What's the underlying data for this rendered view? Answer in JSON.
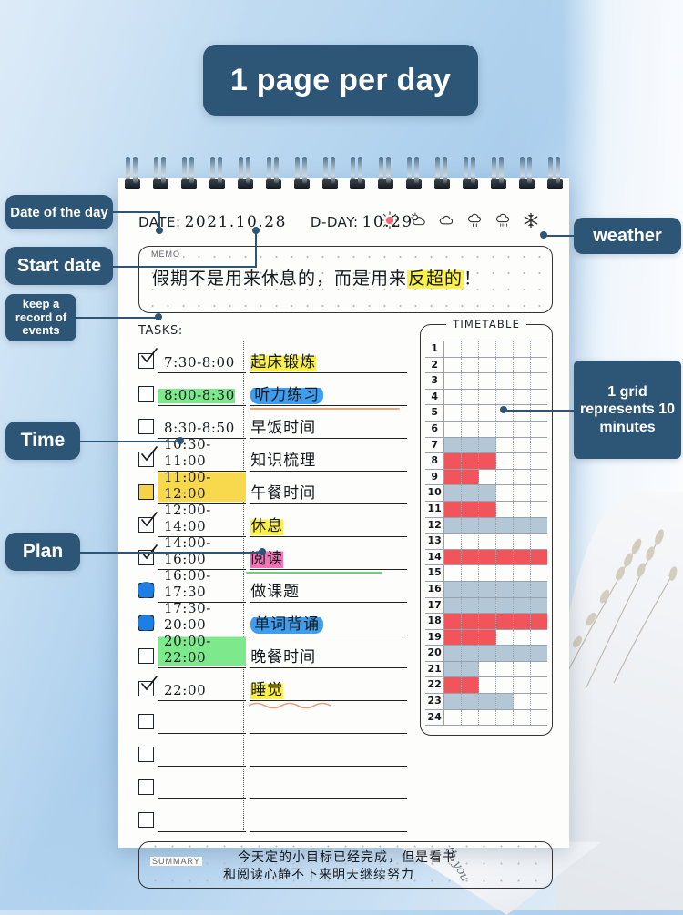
{
  "banner": {
    "title": "1 page per day"
  },
  "callouts": {
    "date_of_day": "Date of the day",
    "start_date": "Start date",
    "keep_record": "keep a record of events",
    "time": "Time",
    "plan": "Plan",
    "weather": "weather",
    "grid_note": "1 grid represents 10 minutes"
  },
  "header": {
    "date_label": "DATE:",
    "date_value": "2021.10.28",
    "dday_label": "D-DAY:",
    "dday_value": "10.29",
    "weather_icons": [
      "sun-icon",
      "sun-cloud-icon",
      "cloud-icon",
      "rain-icon",
      "heavy-rain-icon",
      "snow-icon"
    ]
  },
  "memo": {
    "label": "MEMO",
    "text_plain": "假期不是用来休息的，而是用来",
    "text_highlight": "反超的",
    "text_tail": "！"
  },
  "tasks": {
    "heading": "TASKS:",
    "rows": [
      {
        "check": "checked",
        "time": "7:30-8:00",
        "time_hl": "none",
        "plan": "起床锻炼",
        "plan_hl": "yellow"
      },
      {
        "check": "empty",
        "time": "8:00-8:30",
        "time_hl": "green",
        "plan": "听力练习",
        "plan_hl": "blue"
      },
      {
        "check": "empty",
        "time": "8:30-8:50",
        "time_hl": "none",
        "plan": "早饭时间",
        "plan_hl": "none"
      },
      {
        "check": "checked",
        "time": "10:30-11:00",
        "time_hl": "none",
        "plan": "知识梳理",
        "plan_hl": "none"
      },
      {
        "check": "yellow",
        "time": "11:00-12:00",
        "time_hl": "yellow",
        "plan": "午餐时间",
        "plan_hl": "none"
      },
      {
        "check": "checked",
        "time": "12:00-14:00",
        "time_hl": "none",
        "plan": "休息",
        "plan_hl": "yellow"
      },
      {
        "check": "checked",
        "time": "14:00-16:00",
        "time_hl": "none",
        "plan": "阅读",
        "plan_hl": "pink"
      },
      {
        "check": "blue",
        "time": "16:00-17:30",
        "time_hl": "none",
        "plan": "做课题",
        "plan_hl": "none"
      },
      {
        "check": "blue",
        "time": "17:30-20:00",
        "time_hl": "none",
        "plan": "单词背诵",
        "plan_hl": "blue"
      },
      {
        "check": "empty",
        "time": "20:00-22:00",
        "time_hl": "green",
        "plan": "晚餐时间",
        "plan_hl": "none"
      },
      {
        "check": "checked",
        "time": "22:00",
        "time_hl": "none",
        "plan": "睡觉",
        "plan_hl": "yellow"
      },
      {
        "check": "empty",
        "time": "",
        "time_hl": "none",
        "plan": "",
        "plan_hl": "none"
      },
      {
        "check": "empty",
        "time": "",
        "time_hl": "none",
        "plan": "",
        "plan_hl": "none"
      },
      {
        "check": "empty",
        "time": "",
        "time_hl": "none",
        "plan": "",
        "plan_hl": "none"
      },
      {
        "check": "empty",
        "time": "",
        "time_hl": "none",
        "plan": "",
        "plan_hl": "none"
      }
    ]
  },
  "timetable": {
    "title": "TIMETABLE",
    "columns_per_row": 6,
    "minutes_per_cell": 10,
    "rows": [
      {
        "hour": "1",
        "cells": [
          "",
          "",
          "",
          "",
          "",
          ""
        ]
      },
      {
        "hour": "2",
        "cells": [
          "",
          "",
          "",
          "",
          "",
          ""
        ]
      },
      {
        "hour": "3",
        "cells": [
          "",
          "",
          "",
          "",
          "",
          ""
        ]
      },
      {
        "hour": "4",
        "cells": [
          "",
          "",
          "",
          "",
          "",
          ""
        ]
      },
      {
        "hour": "5",
        "cells": [
          "",
          "",
          "",
          "",
          "",
          ""
        ]
      },
      {
        "hour": "6",
        "cells": [
          "",
          "",
          "",
          "",
          "",
          ""
        ]
      },
      {
        "hour": "7",
        "cells": [
          "b",
          "b",
          "b",
          "",
          "",
          ""
        ]
      },
      {
        "hour": "8",
        "cells": [
          "r",
          "r",
          "r",
          "",
          "",
          ""
        ]
      },
      {
        "hour": "9",
        "cells": [
          "r",
          "r",
          "",
          "",
          "",
          ""
        ]
      },
      {
        "hour": "10",
        "cells": [
          "b",
          "b",
          "b",
          "",
          "",
          ""
        ]
      },
      {
        "hour": "11",
        "cells": [
          "r",
          "r",
          "r",
          "",
          "",
          ""
        ]
      },
      {
        "hour": "12",
        "cells": [
          "b",
          "b",
          "b",
          "b",
          "b",
          "b"
        ]
      },
      {
        "hour": "13",
        "cells": [
          "",
          "",
          "",
          "",
          "",
          ""
        ]
      },
      {
        "hour": "14",
        "cells": [
          "r",
          "r",
          "r",
          "r",
          "r",
          "r"
        ]
      },
      {
        "hour": "15",
        "cells": [
          "",
          "",
          "",
          "",
          "",
          ""
        ]
      },
      {
        "hour": "16",
        "cells": [
          "b",
          "b",
          "b",
          "b",
          "b",
          "b"
        ]
      },
      {
        "hour": "17",
        "cells": [
          "b",
          "b",
          "b",
          "b",
          "b",
          "b"
        ]
      },
      {
        "hour": "18",
        "cells": [
          "r",
          "r",
          "r",
          "r",
          "r",
          "r"
        ]
      },
      {
        "hour": "19",
        "cells": [
          "r",
          "r",
          "r",
          "",
          "",
          ""
        ]
      },
      {
        "hour": "20",
        "cells": [
          "b",
          "b",
          "b",
          "b",
          "b",
          "b"
        ]
      },
      {
        "hour": "21",
        "cells": [
          "b",
          "b",
          "",
          "",
          "",
          ""
        ]
      },
      {
        "hour": "22",
        "cells": [
          "r",
          "r",
          "",
          "",
          "",
          ""
        ]
      },
      {
        "hour": "23",
        "cells": [
          "b",
          "b",
          "b",
          "b",
          "",
          ""
        ]
      },
      {
        "hour": "24",
        "cells": [
          "",
          "",
          "",
          "",
          "",
          ""
        ]
      }
    ]
  },
  "summary": {
    "label": "SUMMARY",
    "line1": "今天定的小目标已经完成，但是看书",
    "line2": "和阅读心静不下来明天继续努力"
  },
  "corner": {
    "script": "with you"
  },
  "colors": {
    "accent": "#2d5576",
    "timetable_blue": "#b3c7d6",
    "timetable_red": "#f2545b",
    "highlight_yellow": "#fbef4a",
    "highlight_green": "#7ee88d",
    "highlight_blue": "#3d9ef0",
    "highlight_pink": "#f472b6"
  }
}
